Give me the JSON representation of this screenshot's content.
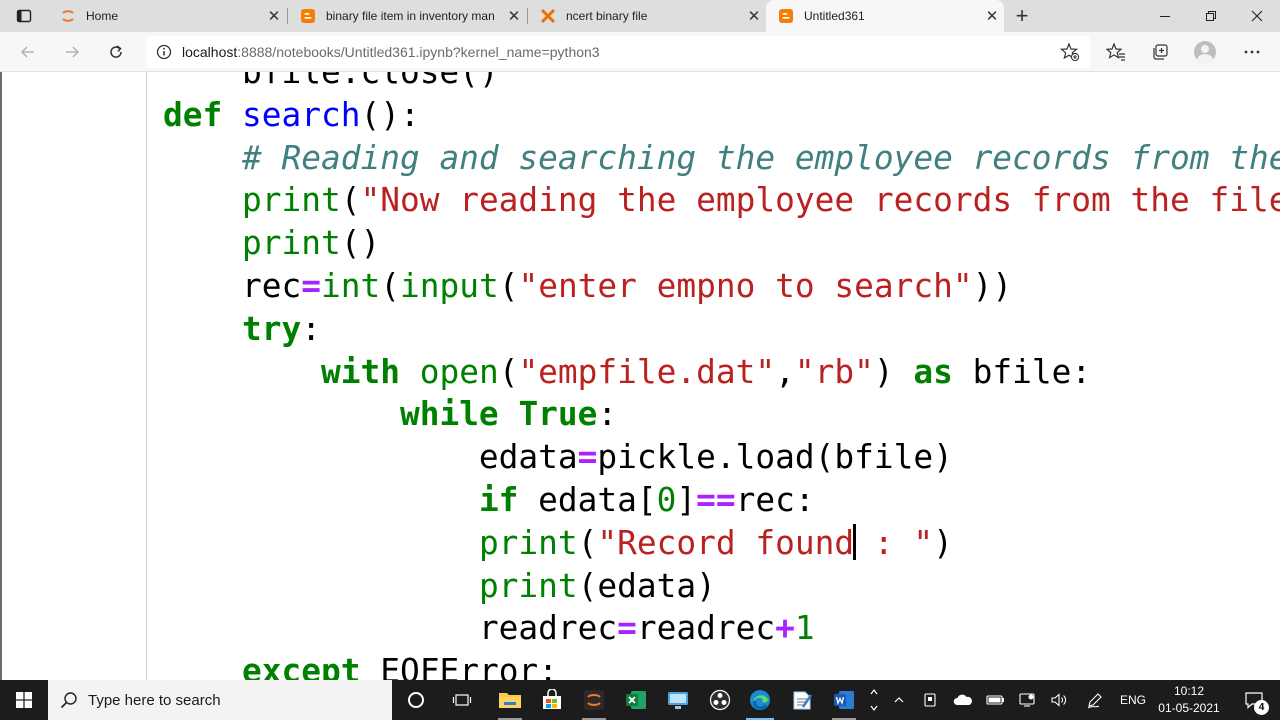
{
  "browser": {
    "tabs": [
      {
        "title": "Home",
        "icon": "jupyter-icon",
        "active": false
      },
      {
        "title": "binary file item in inventory man",
        "icon": "blogger-icon",
        "active": false
      },
      {
        "title": "ncert binary file",
        "icon": "ncert-icon",
        "active": false
      },
      {
        "title": "Untitled361",
        "icon": "blogger-icon",
        "active": true
      }
    ],
    "address": {
      "host": "localhost",
      "rest": ":8888/notebooks/Untitled361.ipynb?kernel_name=python3"
    }
  },
  "notebook": {
    "code_lines": [
      [
        {
          "t": "    bfile.close()",
          "c": ""
        }
      ],
      [
        {
          "t": "def",
          "c": "kw"
        },
        {
          "t": " ",
          "c": ""
        },
        {
          "t": "search",
          "c": "fn"
        },
        {
          "t": "():",
          "c": ""
        }
      ],
      [
        {
          "t": "    ",
          "c": ""
        },
        {
          "t": "# Reading and searching the employee records from the file",
          "c": "cm"
        }
      ],
      [
        {
          "t": "    ",
          "c": ""
        },
        {
          "t": "print",
          "c": "bi"
        },
        {
          "t": "(",
          "c": ""
        },
        {
          "t": "\"Now reading the employee records from the file\"",
          "c": "str"
        },
        {
          "t": ")",
          "c": ""
        }
      ],
      [
        {
          "t": "    ",
          "c": ""
        },
        {
          "t": "print",
          "c": "bi"
        },
        {
          "t": "()",
          "c": ""
        }
      ],
      [
        {
          "t": "    rec",
          "c": ""
        },
        {
          "t": "=",
          "c": "op"
        },
        {
          "t": "int",
          "c": "bi"
        },
        {
          "t": "(",
          "c": ""
        },
        {
          "t": "input",
          "c": "bi"
        },
        {
          "t": "(",
          "c": ""
        },
        {
          "t": "\"enter empno to search\"",
          "c": "str"
        },
        {
          "t": "))",
          "c": ""
        }
      ],
      [
        {
          "t": "    ",
          "c": ""
        },
        {
          "t": "try",
          "c": "kw"
        },
        {
          "t": ":",
          "c": ""
        }
      ],
      [
        {
          "t": "        ",
          "c": ""
        },
        {
          "t": "with",
          "c": "kw"
        },
        {
          "t": " ",
          "c": ""
        },
        {
          "t": "open",
          "c": "bi"
        },
        {
          "t": "(",
          "c": ""
        },
        {
          "t": "\"empfile.dat\"",
          "c": "str"
        },
        {
          "t": ",",
          "c": ""
        },
        {
          "t": "\"rb\"",
          "c": "str"
        },
        {
          "t": ") ",
          "c": ""
        },
        {
          "t": "as",
          "c": "kw"
        },
        {
          "t": " bfile:",
          "c": ""
        }
      ],
      [
        {
          "t": "            ",
          "c": ""
        },
        {
          "t": "while",
          "c": "kw"
        },
        {
          "t": " ",
          "c": ""
        },
        {
          "t": "True",
          "c": "kw"
        },
        {
          "t": ":",
          "c": ""
        }
      ],
      [
        {
          "t": "                edata",
          "c": ""
        },
        {
          "t": "=",
          "c": "op"
        },
        {
          "t": "pickle.load(bfile)",
          "c": ""
        }
      ],
      [
        {
          "t": "                ",
          "c": ""
        },
        {
          "t": "if",
          "c": "kw"
        },
        {
          "t": " edata[",
          "c": ""
        },
        {
          "t": "0",
          "c": "num"
        },
        {
          "t": "]",
          "c": ""
        },
        {
          "t": "==",
          "c": "op"
        },
        {
          "t": "rec:",
          "c": ""
        }
      ],
      [
        {
          "t": "                ",
          "c": ""
        },
        {
          "t": "print",
          "c": "bi"
        },
        {
          "t": "(",
          "c": ""
        },
        {
          "t": "\"Record found",
          "c": "str"
        },
        {
          "t": "",
          "c": "cursor"
        },
        {
          "t": " : \"",
          "c": "str"
        },
        {
          "t": ")",
          "c": ""
        }
      ],
      [
        {
          "t": "                ",
          "c": ""
        },
        {
          "t": "print",
          "c": "bi"
        },
        {
          "t": "(edata)",
          "c": ""
        }
      ],
      [
        {
          "t": "                readrec",
          "c": ""
        },
        {
          "t": "=",
          "c": "op"
        },
        {
          "t": "readrec",
          "c": ""
        },
        {
          "t": "+",
          "c": "op"
        },
        {
          "t": "1",
          "c": "num"
        }
      ],
      [
        {
          "t": "    ",
          "c": ""
        },
        {
          "t": "except",
          "c": "kw"
        },
        {
          "t": " ",
          "c": ""
        },
        {
          "t": "EOFError",
          "c": "err"
        },
        {
          "t": ":",
          "c": ""
        }
      ]
    ]
  },
  "taskbar": {
    "search_placeholder": "Type here to search",
    "language": "ENG",
    "time": "10:12",
    "date": "01-05-2021",
    "notification_count": "4"
  },
  "colors": {
    "keyword": "#008000",
    "string": "#ba2121",
    "comment": "#408080",
    "operator": "#aa22ff",
    "function_name": "#0000ff",
    "taskbar": "#1c1c1c"
  }
}
